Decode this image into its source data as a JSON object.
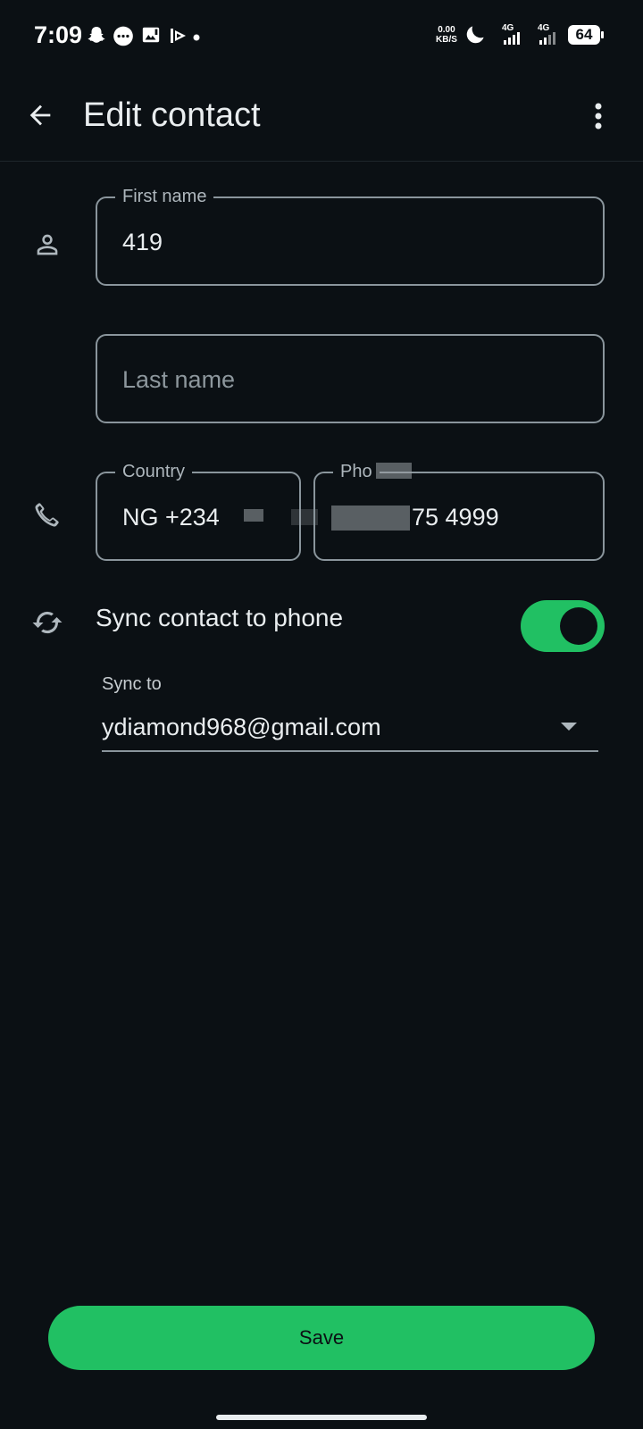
{
  "status_bar": {
    "time": "7:09",
    "net_speed_value": "0.00",
    "net_speed_unit": "KB/S",
    "signal1_label": "4G",
    "signal2_label": "4G",
    "battery": "64",
    "icons": [
      "snapchat-icon",
      "messages-icon",
      "gallery-icon",
      "cast-icon",
      "dot-icon",
      "moon-icon",
      "signal-icon",
      "signal-icon",
      "battery-icon"
    ]
  },
  "app_bar": {
    "title": "Edit contact"
  },
  "form": {
    "first_name": {
      "label": "First name",
      "value": "419"
    },
    "last_name": {
      "placeholder": "Last name"
    },
    "country": {
      "label": "Country",
      "value": "NG +234"
    },
    "phone": {
      "label": "Pho",
      "value": "75 4999"
    }
  },
  "sync": {
    "label": "Sync contact to phone",
    "enabled": true,
    "sync_to_label": "Sync to",
    "account": "ydiamond968@gmail.com"
  },
  "save_button": {
    "label": "Save"
  },
  "colors": {
    "background": "#0b1014",
    "accent": "#21c063",
    "text": "#e9edef",
    "outline": "#8a959c"
  }
}
